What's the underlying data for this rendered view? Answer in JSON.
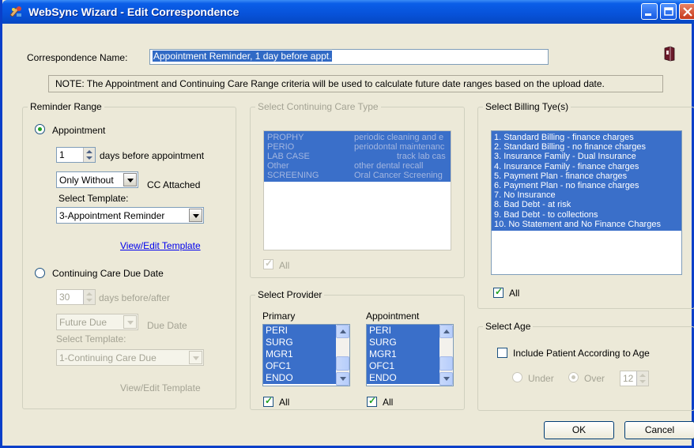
{
  "window": {
    "title": "WebSync Wizard - Edit Correspondence",
    "icon": "wizard-app-icon",
    "controls": [
      "minimize-icon",
      "maximize-icon",
      "close-icon"
    ]
  },
  "correspondence": {
    "label": "Correspondence Name:",
    "value": "Appointment Reminder, 1 day before appt."
  },
  "note": "NOTE:  The Appointment and Continuing Care Range criteria will be used to calculate future date ranges based on the upload date.",
  "reminder_range": {
    "title": "Reminder Range",
    "appointment": {
      "label": "Appointment",
      "selected": true,
      "days_value": "1",
      "days_label": "days before appointment",
      "cc_option": "Only Without",
      "cc_label": "CC Attached",
      "template_label": "Select Template:",
      "template_value": "3-Appointment Reminder",
      "view_link": "View/Edit Template"
    },
    "continuing_care": {
      "label": "Continuing Care Due Date",
      "selected": false,
      "days_value": "30",
      "days_label": "days before/after",
      "due_option": "Future Due",
      "due_label": "Due Date",
      "template_label": "Select Template:",
      "template_value": "1-Continuing Care Due",
      "view_link": "View/Edit Template"
    }
  },
  "cc_type": {
    "title": "Select Continuing Care Type",
    "items": [
      {
        "code": "PROPHY",
        "desc": "periodic cleaning and e"
      },
      {
        "code": "PERIO",
        "desc": "periodontal maintenanc"
      },
      {
        "code": "LAB CASE",
        "desc": "track lab cas"
      },
      {
        "code": "Other",
        "desc": "other dental recall"
      },
      {
        "code": "SCREENING",
        "desc": "Oral Cancer Screening"
      }
    ],
    "all_label": "All",
    "all_checked": true
  },
  "billing": {
    "title": "Select Billing Tye(s)",
    "items": [
      "1. Standard Billing - finance charges",
      "2. Standard Billing - no finance charges",
      "3. Insurance Family - Dual Insurance",
      "4. Insurance Family - finance charges",
      "5. Payment Plan - finance charges",
      "6. Payment Plan - no finance charges",
      "7. No Insurance",
      "8. Bad Debt - at risk",
      "9. Bad Debt - to collections",
      "10. No Statement and No Finance Charges"
    ],
    "all_label": "All",
    "all_checked": true
  },
  "provider": {
    "title": "Select Provider",
    "primary_label": "Primary",
    "appointment_label": "Appointment",
    "primary_items": [
      "PERI",
      "SURG",
      "MGR1",
      "OFC1",
      "ENDO"
    ],
    "appointment_items": [
      "PERI",
      "SURG",
      "MGR1",
      "OFC1",
      "ENDO"
    ],
    "all_label": "All",
    "primary_all_checked": true,
    "appointment_all_checked": true
  },
  "age": {
    "title": "Select Age",
    "include_label": "Include Patient According to Age",
    "include_checked": false,
    "under_label": "Under",
    "over_label": "Over",
    "over_selected": true,
    "age_value": "12"
  },
  "buttons": {
    "ok": "OK",
    "cancel": "Cancel"
  },
  "colors": {
    "titlebar": "#0752d9",
    "selection": "#316ac5",
    "dialog_bg": "#ece9d8",
    "link": "#0000ee"
  }
}
